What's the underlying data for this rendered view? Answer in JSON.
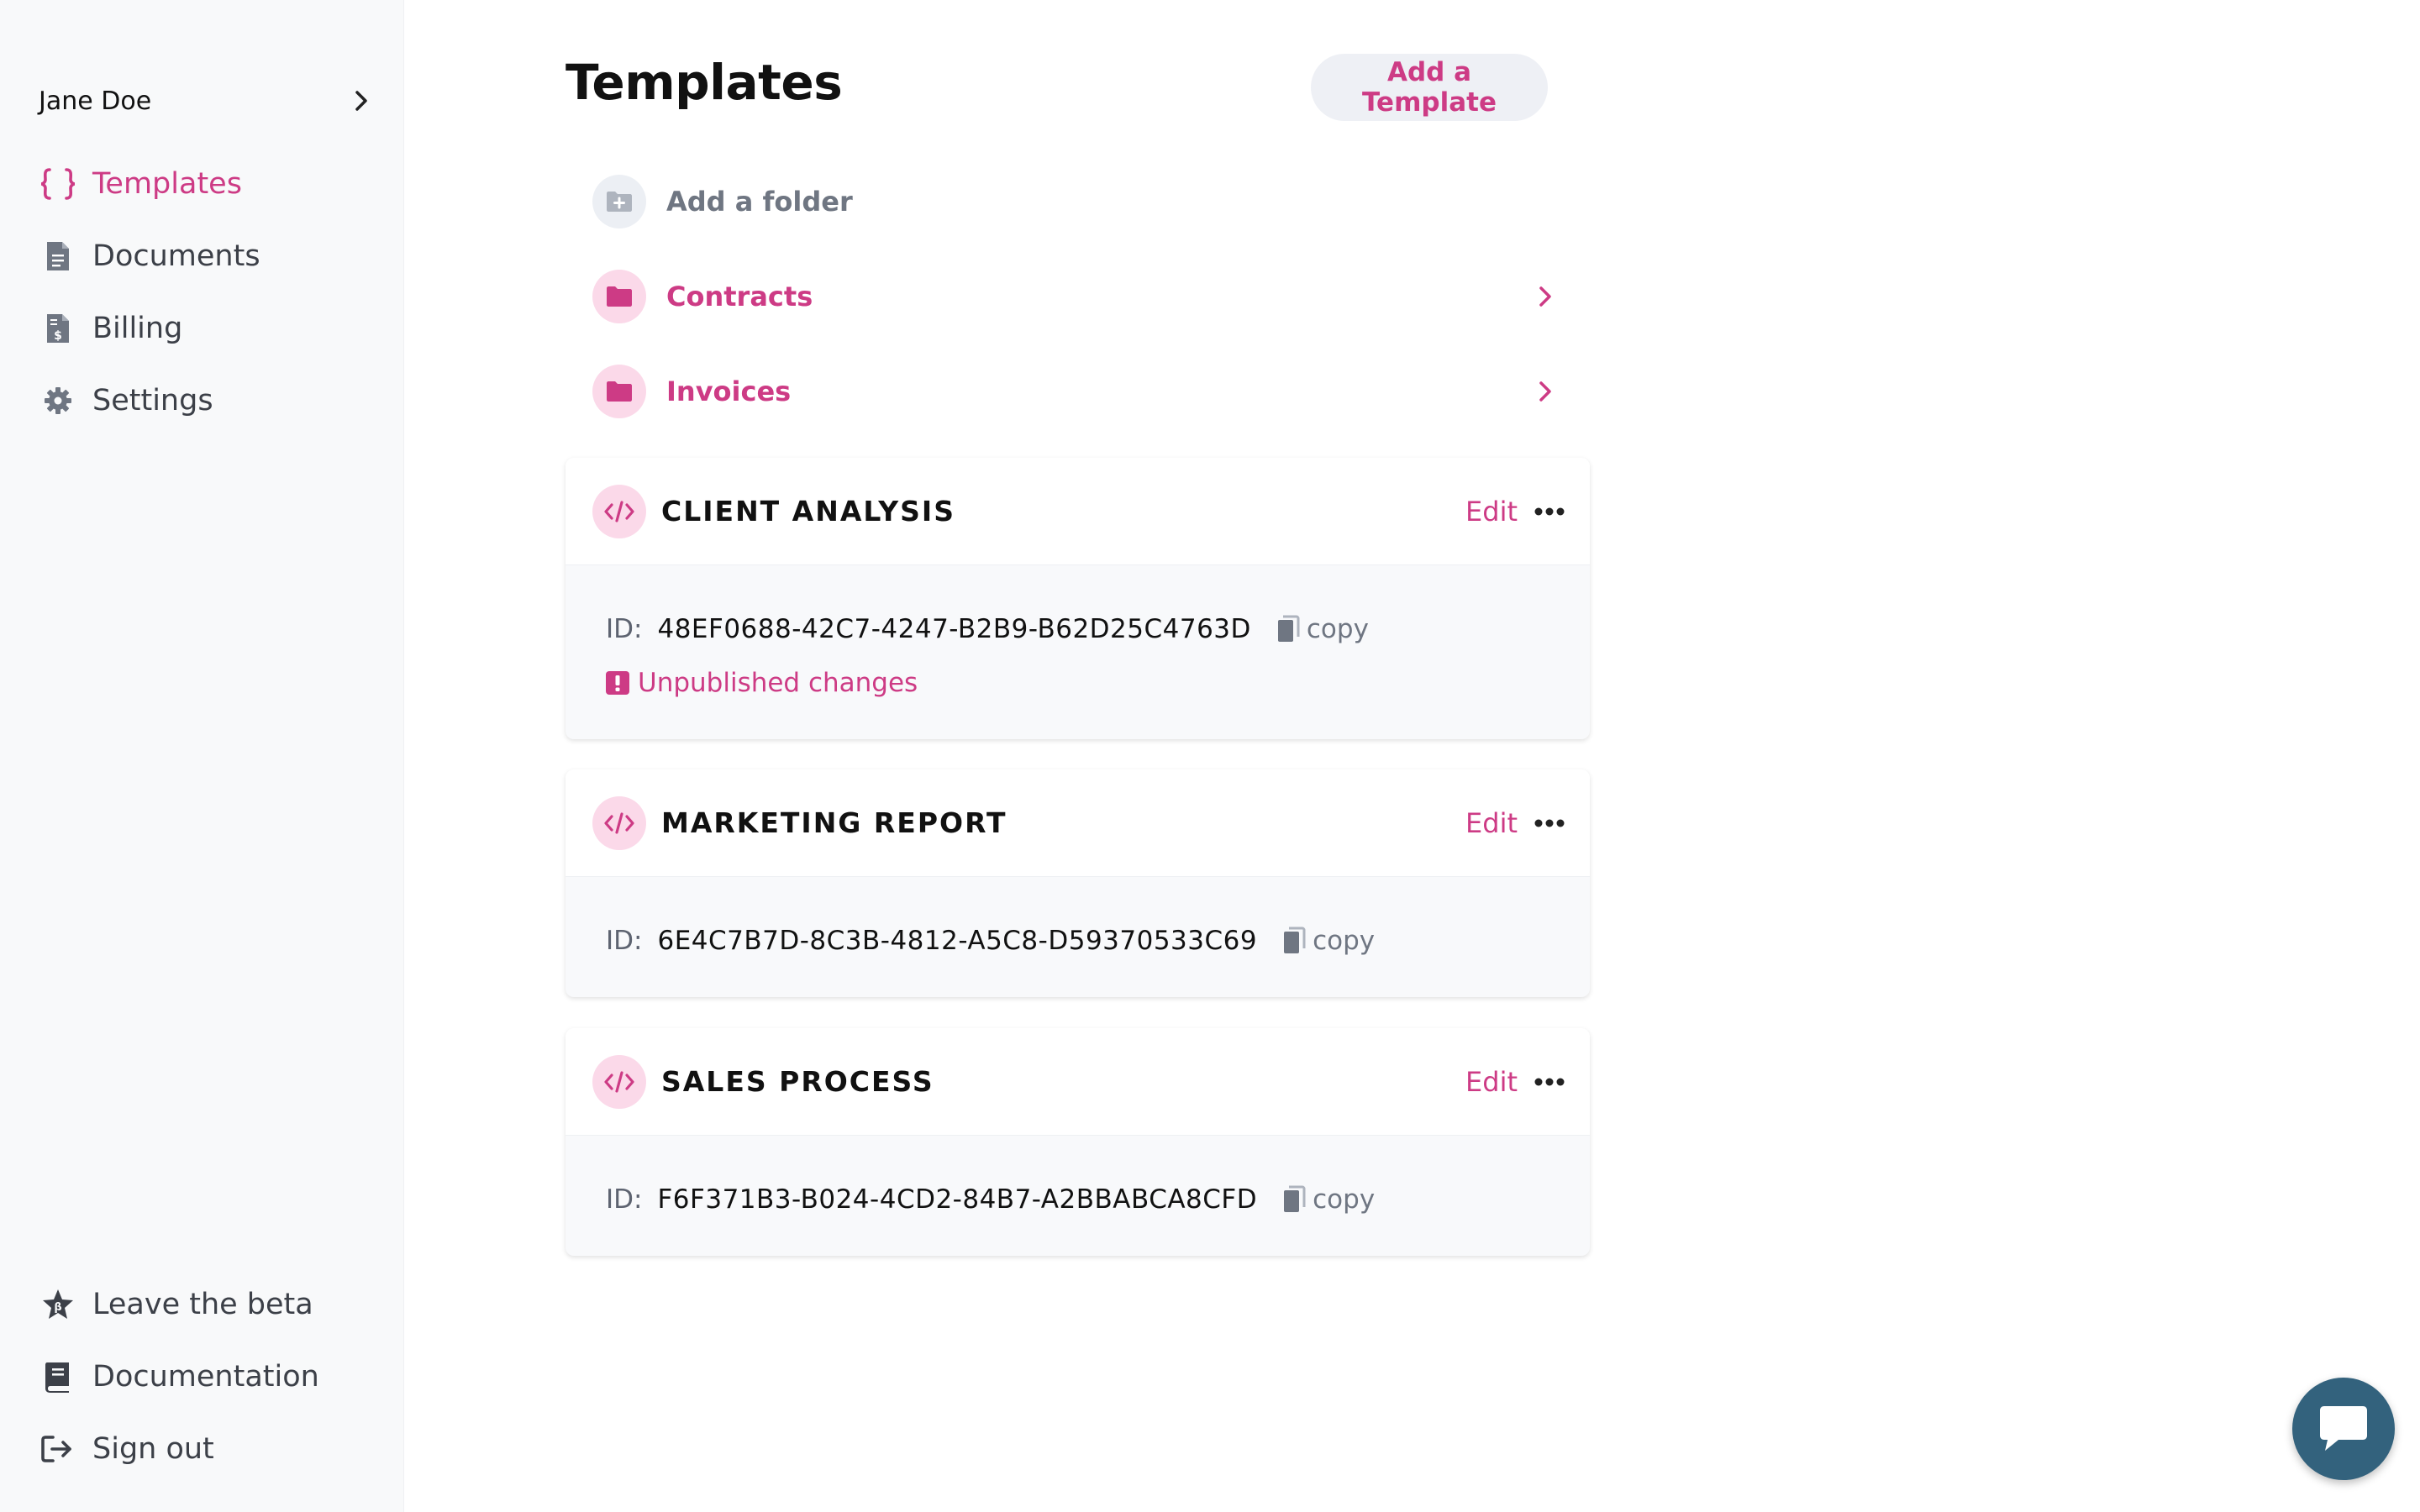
{
  "sidebar": {
    "user_name": "Jane Doe",
    "nav": [
      {
        "label": "Templates",
        "icon": "braces-icon",
        "active": true
      },
      {
        "label": "Documents",
        "icon": "document-icon",
        "active": false
      },
      {
        "label": "Billing",
        "icon": "invoice-icon",
        "active": false
      },
      {
        "label": "Settings",
        "icon": "gear-icon",
        "active": false
      }
    ],
    "footer": [
      {
        "label": "Leave the beta",
        "icon": "star-icon"
      },
      {
        "label": "Documentation",
        "icon": "book-icon"
      },
      {
        "label": "Sign out",
        "icon": "sign-out-icon"
      }
    ]
  },
  "main": {
    "title": "Templates",
    "add_template_label": "Add a Template",
    "add_folder_label": "Add a folder",
    "folders": [
      {
        "name": "Contracts"
      },
      {
        "name": "Invoices"
      }
    ],
    "templates": [
      {
        "name": "CLIENT ANALYSIS",
        "edit_label": "Edit",
        "id_label": "ID:",
        "id": "48EF0688-42C7-4247-B2B9-B62D25C4763D",
        "copy_label": "copy",
        "status": "Unpublished changes"
      },
      {
        "name": "MARKETING REPORT",
        "edit_label": "Edit",
        "id_label": "ID:",
        "id": "6E4C7B7D-8C3B-4812-A5C8-D59370533C69",
        "copy_label": "copy"
      },
      {
        "name": "SALES PROCESS",
        "edit_label": "Edit",
        "id_label": "ID:",
        "id": "F6F371B3-B024-4CD2-84B7-A2BBABCA8CFD",
        "copy_label": "copy"
      }
    ]
  },
  "colors": {
    "accent": "#cd3b85",
    "accent_soft": "#fbd9e9",
    "sidebar_bg": "#f8f9fa",
    "chat_button": "#33627d"
  },
  "chat": {
    "icon": "chat-bubble-icon"
  }
}
